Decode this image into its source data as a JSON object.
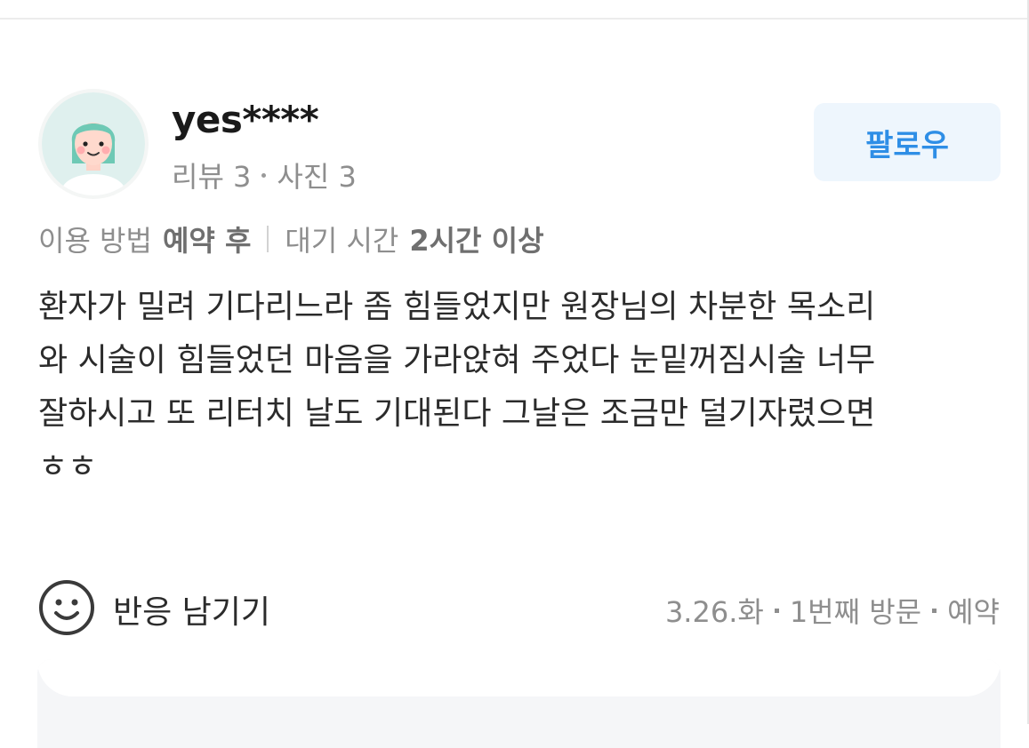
{
  "user": {
    "name": "yes****",
    "stats": {
      "reviews": "리뷰 3",
      "photos": "사진 3"
    }
  },
  "follow_button": {
    "label": "팔로우"
  },
  "meta": {
    "usage_label": "이용 방법",
    "usage_value": "예약 후",
    "wait_label": "대기 시간",
    "wait_value": "2시간 이상"
  },
  "review": {
    "text": "환자가 밀려 기다리느라 좀 힘들었지만 원장님의 차분한 목소리\n와 시술이 힘들었던 마음을 가라앉혀 주었다 눈밑꺼짐시술 너무\n잘하시고 또 리터치 날도 기대된다 그날은 조금만 덜기자렸으면\nㅎㅎ"
  },
  "reaction": {
    "label": "반응 남기기",
    "icon": "smile-icon"
  },
  "visit": {
    "date": "3.26.화",
    "count": "1번째 방문",
    "type": "예약"
  },
  "colors": {
    "accent": "#2e8ee6",
    "follow_bg": "#eef6fd",
    "muted_text": "#8e8e8e",
    "avatar_hair": "#6ec9b5"
  }
}
